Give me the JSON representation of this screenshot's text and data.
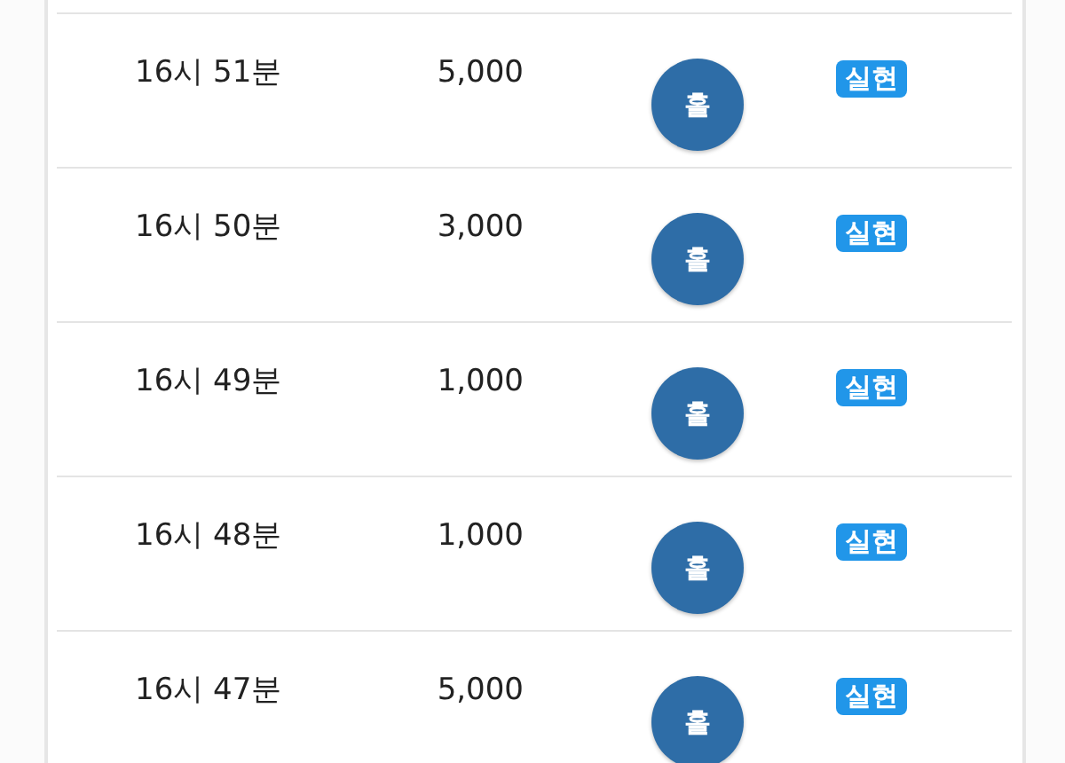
{
  "rows": [
    {
      "time": "16시 51분",
      "amount": "5,000",
      "pick": "홀",
      "status": "실현"
    },
    {
      "time": "16시 50분",
      "amount": "3,000",
      "pick": "홀",
      "status": "실현"
    },
    {
      "time": "16시 49분",
      "amount": "1,000",
      "pick": "홀",
      "status": "실현"
    },
    {
      "time": "16시 48분",
      "amount": "1,000",
      "pick": "홀",
      "status": "실현"
    },
    {
      "time": "16시 47분",
      "amount": "5,000",
      "pick": "홀",
      "status": "실현"
    }
  ]
}
